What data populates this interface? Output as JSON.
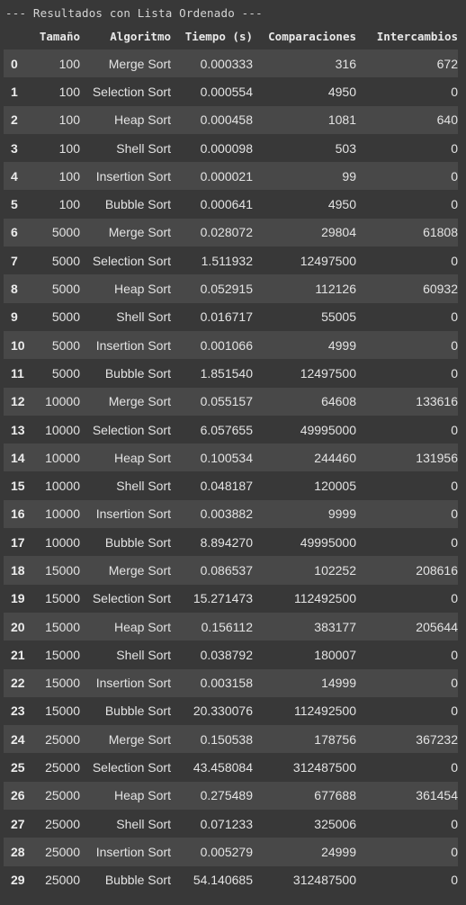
{
  "header_text": "--- Resultados con Lista Ordenado ---",
  "columns": {
    "index": "",
    "size": "Tamaño",
    "algorithm": "Algoritmo",
    "time": "Tiempo (s)",
    "comparisons": "Comparaciones",
    "swaps": "Intercambios"
  },
  "rows": [
    {
      "i": "0",
      "size": "100",
      "algo": "Merge Sort",
      "time": "0.000333",
      "comp": "316",
      "swaps": "672"
    },
    {
      "i": "1",
      "size": "100",
      "algo": "Selection Sort",
      "time": "0.000554",
      "comp": "4950",
      "swaps": "0"
    },
    {
      "i": "2",
      "size": "100",
      "algo": "Heap Sort",
      "time": "0.000458",
      "comp": "1081",
      "swaps": "640"
    },
    {
      "i": "3",
      "size": "100",
      "algo": "Shell Sort",
      "time": "0.000098",
      "comp": "503",
      "swaps": "0"
    },
    {
      "i": "4",
      "size": "100",
      "algo": "Insertion Sort",
      "time": "0.000021",
      "comp": "99",
      "swaps": "0"
    },
    {
      "i": "5",
      "size": "100",
      "algo": "Bubble Sort",
      "time": "0.000641",
      "comp": "4950",
      "swaps": "0"
    },
    {
      "i": "6",
      "size": "5000",
      "algo": "Merge Sort",
      "time": "0.028072",
      "comp": "29804",
      "swaps": "61808"
    },
    {
      "i": "7",
      "size": "5000",
      "algo": "Selection Sort",
      "time": "1.511932",
      "comp": "12497500",
      "swaps": "0"
    },
    {
      "i": "8",
      "size": "5000",
      "algo": "Heap Sort",
      "time": "0.052915",
      "comp": "112126",
      "swaps": "60932"
    },
    {
      "i": "9",
      "size": "5000",
      "algo": "Shell Sort",
      "time": "0.016717",
      "comp": "55005",
      "swaps": "0"
    },
    {
      "i": "10",
      "size": "5000",
      "algo": "Insertion Sort",
      "time": "0.001066",
      "comp": "4999",
      "swaps": "0"
    },
    {
      "i": "11",
      "size": "5000",
      "algo": "Bubble Sort",
      "time": "1.851540",
      "comp": "12497500",
      "swaps": "0"
    },
    {
      "i": "12",
      "size": "10000",
      "algo": "Merge Sort",
      "time": "0.055157",
      "comp": "64608",
      "swaps": "133616"
    },
    {
      "i": "13",
      "size": "10000",
      "algo": "Selection Sort",
      "time": "6.057655",
      "comp": "49995000",
      "swaps": "0"
    },
    {
      "i": "14",
      "size": "10000",
      "algo": "Heap Sort",
      "time": "0.100534",
      "comp": "244460",
      "swaps": "131956"
    },
    {
      "i": "15",
      "size": "10000",
      "algo": "Shell Sort",
      "time": "0.048187",
      "comp": "120005",
      "swaps": "0"
    },
    {
      "i": "16",
      "size": "10000",
      "algo": "Insertion Sort",
      "time": "0.003882",
      "comp": "9999",
      "swaps": "0"
    },
    {
      "i": "17",
      "size": "10000",
      "algo": "Bubble Sort",
      "time": "8.894270",
      "comp": "49995000",
      "swaps": "0"
    },
    {
      "i": "18",
      "size": "15000",
      "algo": "Merge Sort",
      "time": "0.086537",
      "comp": "102252",
      "swaps": "208616"
    },
    {
      "i": "19",
      "size": "15000",
      "algo": "Selection Sort",
      "time": "15.271473",
      "comp": "112492500",
      "swaps": "0"
    },
    {
      "i": "20",
      "size": "15000",
      "algo": "Heap Sort",
      "time": "0.156112",
      "comp": "383177",
      "swaps": "205644"
    },
    {
      "i": "21",
      "size": "15000",
      "algo": "Shell Sort",
      "time": "0.038792",
      "comp": "180007",
      "swaps": "0"
    },
    {
      "i": "22",
      "size": "15000",
      "algo": "Insertion Sort",
      "time": "0.003158",
      "comp": "14999",
      "swaps": "0"
    },
    {
      "i": "23",
      "size": "15000",
      "algo": "Bubble Sort",
      "time": "20.330076",
      "comp": "112492500",
      "swaps": "0"
    },
    {
      "i": "24",
      "size": "25000",
      "algo": "Merge Sort",
      "time": "0.150538",
      "comp": "178756",
      "swaps": "367232"
    },
    {
      "i": "25",
      "size": "25000",
      "algo": "Selection Sort",
      "time": "43.458084",
      "comp": "312487500",
      "swaps": "0"
    },
    {
      "i": "26",
      "size": "25000",
      "algo": "Heap Sort",
      "time": "0.275489",
      "comp": "677688",
      "swaps": "361454"
    },
    {
      "i": "27",
      "size": "25000",
      "algo": "Shell Sort",
      "time": "0.071233",
      "comp": "325006",
      "swaps": "0"
    },
    {
      "i": "28",
      "size": "25000",
      "algo": "Insertion Sort",
      "time": "0.005279",
      "comp": "24999",
      "swaps": "0"
    },
    {
      "i": "29",
      "size": "25000",
      "algo": "Bubble Sort",
      "time": "54.140685",
      "comp": "312487500",
      "swaps": "0"
    }
  ]
}
